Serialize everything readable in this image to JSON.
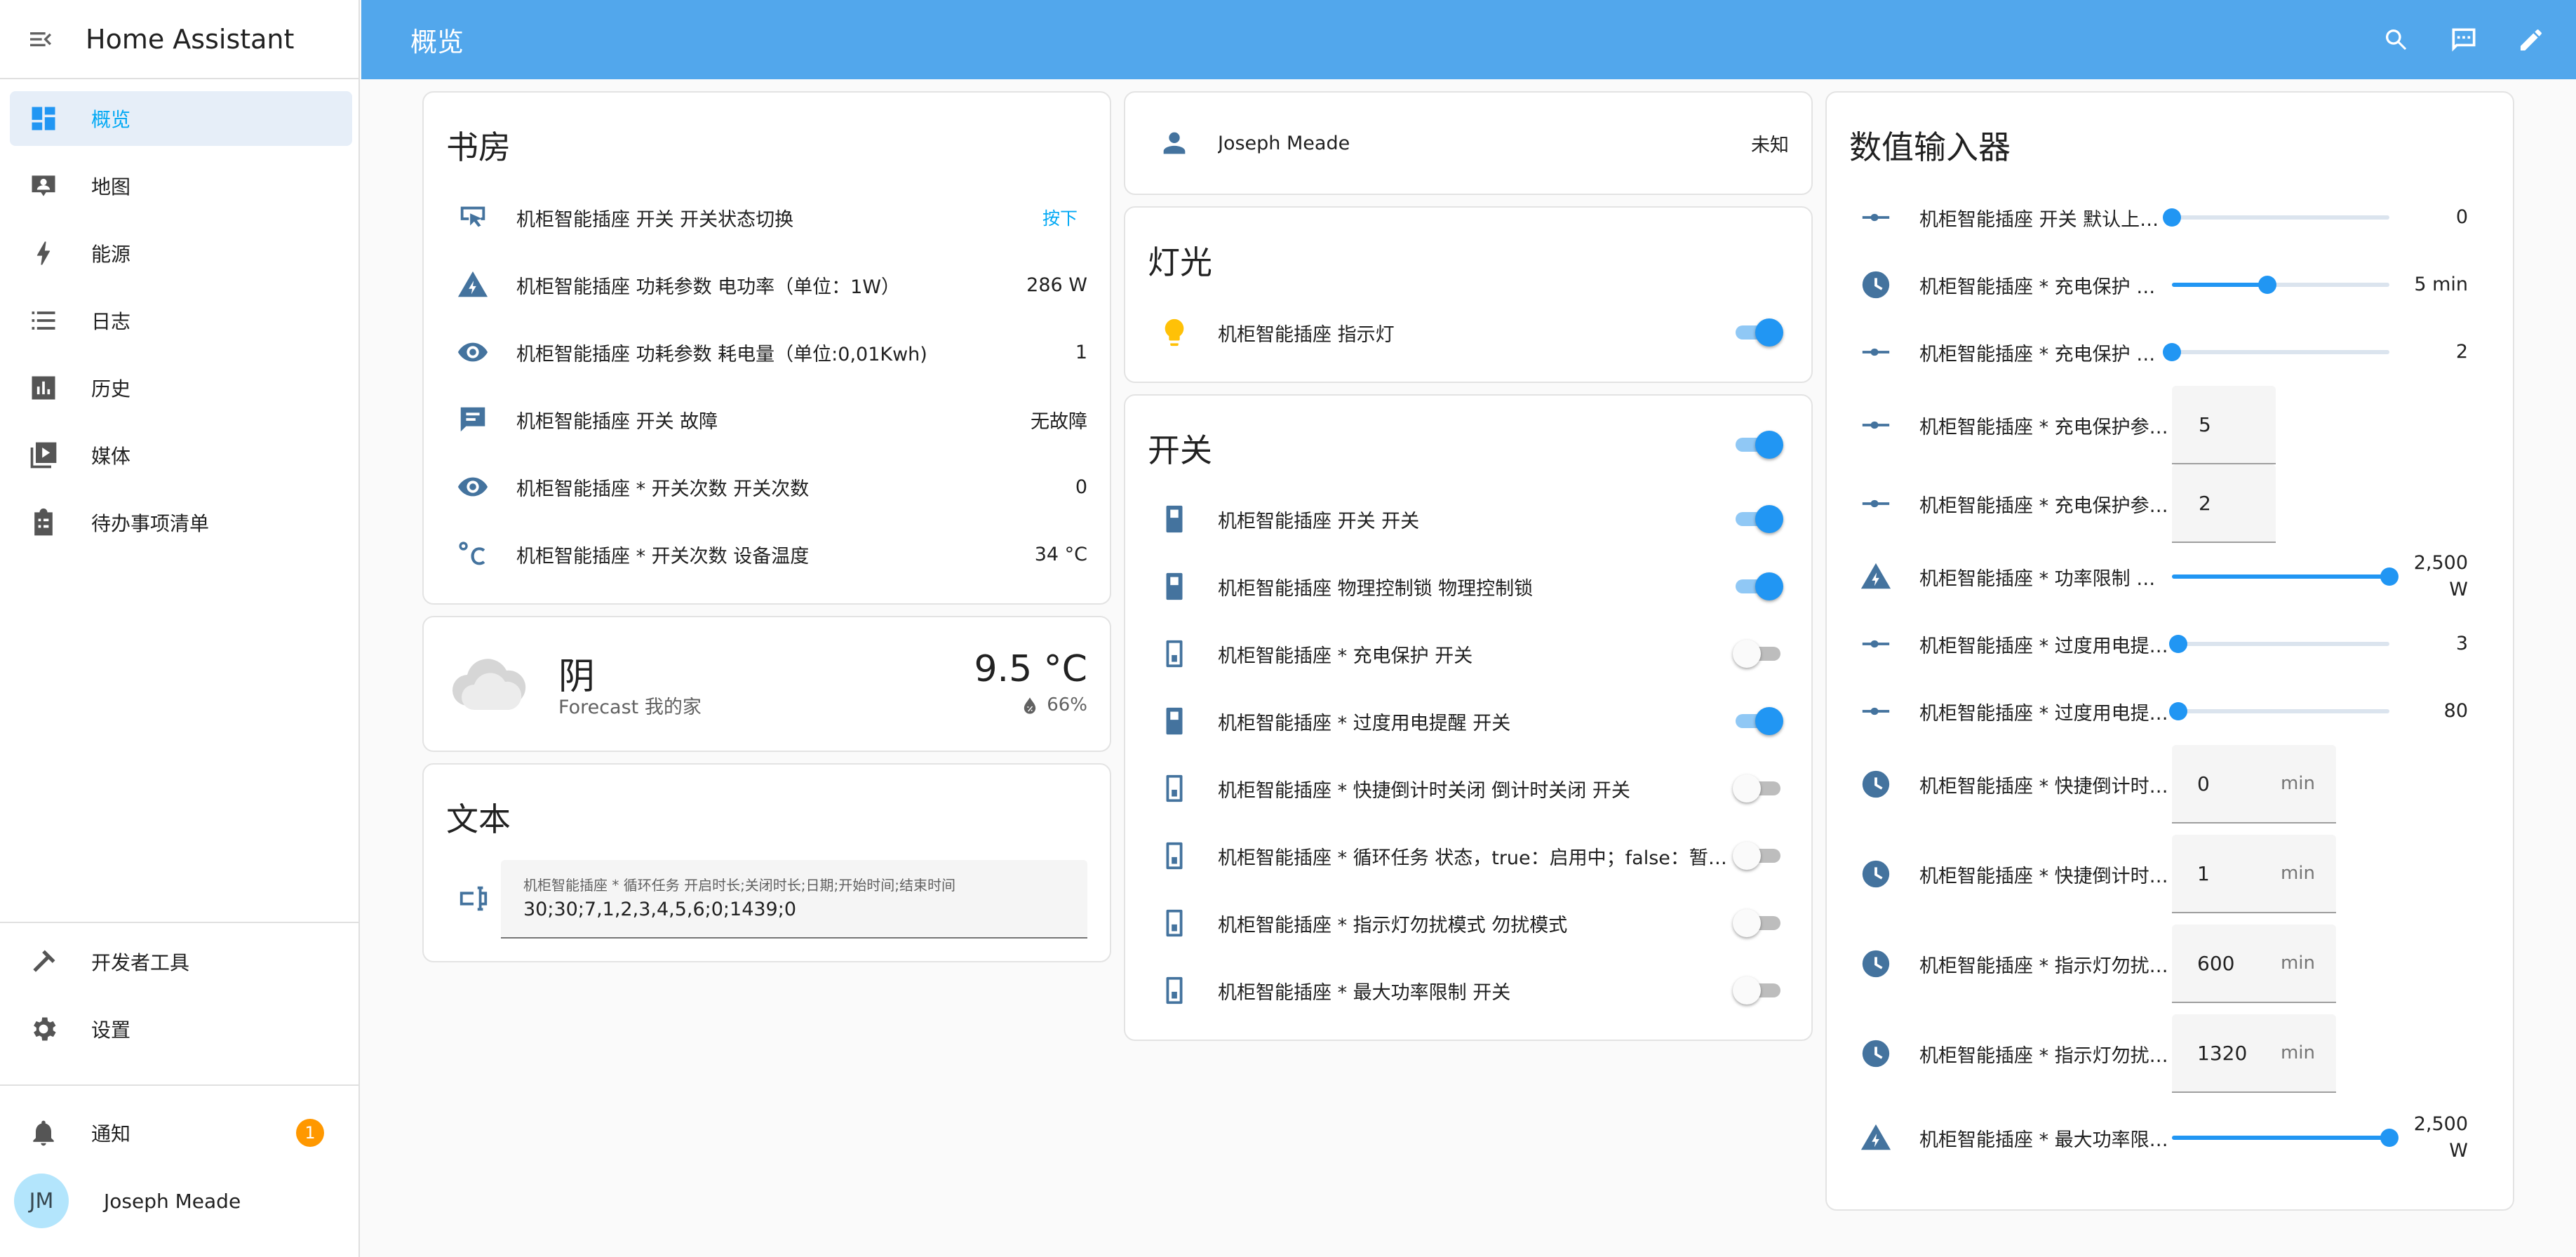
{
  "app": {
    "title": "Home Assistant"
  },
  "header": {
    "title": "概览"
  },
  "sidebar": {
    "items": [
      {
        "label": "概览",
        "icon": "dashboard-icon"
      },
      {
        "label": "地图",
        "icon": "map-icon"
      },
      {
        "label": "能源",
        "icon": "lightning-icon"
      },
      {
        "label": "日志",
        "icon": "list-icon"
      },
      {
        "label": "历史",
        "icon": "chart-icon"
      },
      {
        "label": "媒体",
        "icon": "media-icon"
      },
      {
        "label": "待办事项清单",
        "icon": "clipboard-icon"
      }
    ],
    "dev_tools": "开发者工具",
    "settings": "设置",
    "notifications": "通知",
    "notification_count": "1",
    "user_initials": "JM",
    "user_name": "Joseph Meade"
  },
  "study": {
    "title": "书房",
    "rows": [
      {
        "name": "机柜智能插座 开关 开关状态切换",
        "action": "按下"
      },
      {
        "name": "机柜智能插座 功耗参数 电功率（单位：1W）",
        "value": "286 W"
      },
      {
        "name": "机柜智能插座 功耗参数 耗电量（单位:0,01Kwh)",
        "value": "1"
      },
      {
        "name": "机柜智能插座 开关 故障",
        "value": "无故障"
      },
      {
        "name": "机柜智能插座 * 开关次数 开关次数",
        "value": "0"
      },
      {
        "name": "机柜智能插座 * 开关次数 设备温度",
        "value": "34 °C"
      }
    ]
  },
  "weather": {
    "condition": "阴",
    "forecast_label": "Forecast 我的家",
    "temperature": "9.5 °C",
    "humidity": "66%"
  },
  "text_card": {
    "title": "文本",
    "field_label": "机柜智能插座 * 循环任务 开启时长;关闭时长;日期;开始时间;结束时间",
    "field_value": "30;30;7,1,2,3,4,5,6;0;1439;0"
  },
  "person": {
    "name": "Joseph Meade",
    "state": "未知"
  },
  "lights": {
    "title": "灯光",
    "row": {
      "name": "机柜智能插座 指示灯",
      "on": true
    }
  },
  "switches": {
    "title": "开关",
    "rows": [
      {
        "name": "机柜智能插座 开关 开关",
        "on": true
      },
      {
        "name": "机柜智能插座 物理控制锁 物理控制锁",
        "on": true
      },
      {
        "name": "机柜智能插座 * 充电保护 开关",
        "on": false
      },
      {
        "name": "机柜智能插座 * 过度用电提醒 开关",
        "on": true
      },
      {
        "name": "机柜智能插座 * 快捷倒计时关闭 倒计时关闭 开关",
        "on": false
      },
      {
        "name": "机柜智能插座 * 循环任务 状态，true：启用中；false：暂停中",
        "on": false
      },
      {
        "name": "机柜智能插座 * 指示灯勿扰模式 勿扰模式",
        "on": false
      },
      {
        "name": "机柜智能插座 * 最大功率限制 开关",
        "on": false
      }
    ]
  },
  "numbers": {
    "title": "数值输入器",
    "rows": [
      {
        "name": "机柜智能插座 开关 默认上电状态",
        "type": "slider",
        "fraction": 0.0,
        "value": "0"
      },
      {
        "name": "机柜智能插座 * 充电保护 时长",
        "type": "slider",
        "fraction": 0.44,
        "value": "5 min"
      },
      {
        "name": "机柜智能插座 * 充电保护 功率",
        "type": "slider",
        "fraction": 0.0,
        "value": "2"
      },
      {
        "name": "机柜智能插座 * 充电保护参数 功率",
        "type": "box",
        "value": "5"
      },
      {
        "name": "机柜智能插座 * 充电保护参数 时长",
        "type": "box",
        "value": "2"
      },
      {
        "name": "机柜智能插座 * 功率限制 功率",
        "type": "slider",
        "fraction": 1.0,
        "value": "2,500 W"
      },
      {
        "name": "机柜智能插座 * 过度用电提醒 时长",
        "type": "slider",
        "fraction": 0.03,
        "value": "3"
      },
      {
        "name": "机柜智能插座 * 过度用电提醒 功率",
        "type": "slider",
        "fraction": 0.03,
        "value": "80"
      },
      {
        "name": "机柜智能插座 * 快捷倒计时关闭 时长",
        "type": "boxunit",
        "value": "0",
        "unit": "min"
      },
      {
        "name": "机柜智能插座 * 快捷倒计时关闭 剩余",
        "type": "boxunit",
        "value": "1",
        "unit": "min"
      },
      {
        "name": "机柜智能插座 * 指示灯勿扰模式 开始",
        "type": "boxunit",
        "value": "600",
        "unit": "min"
      },
      {
        "name": "机柜智能插座 * 指示灯勿扰模式 结束",
        "type": "boxunit",
        "value": "1320",
        "unit": "min"
      },
      {
        "name": "机柜智能插座 * 最大功率限制 功率",
        "type": "slider",
        "fraction": 1.0,
        "value": "2,500 W"
      }
    ]
  },
  "colors": {
    "header": "#52a7ec",
    "accent": "#2196f3",
    "icon": "#44739e",
    "bulb": "#ffc107",
    "badge": "#ff9800"
  }
}
